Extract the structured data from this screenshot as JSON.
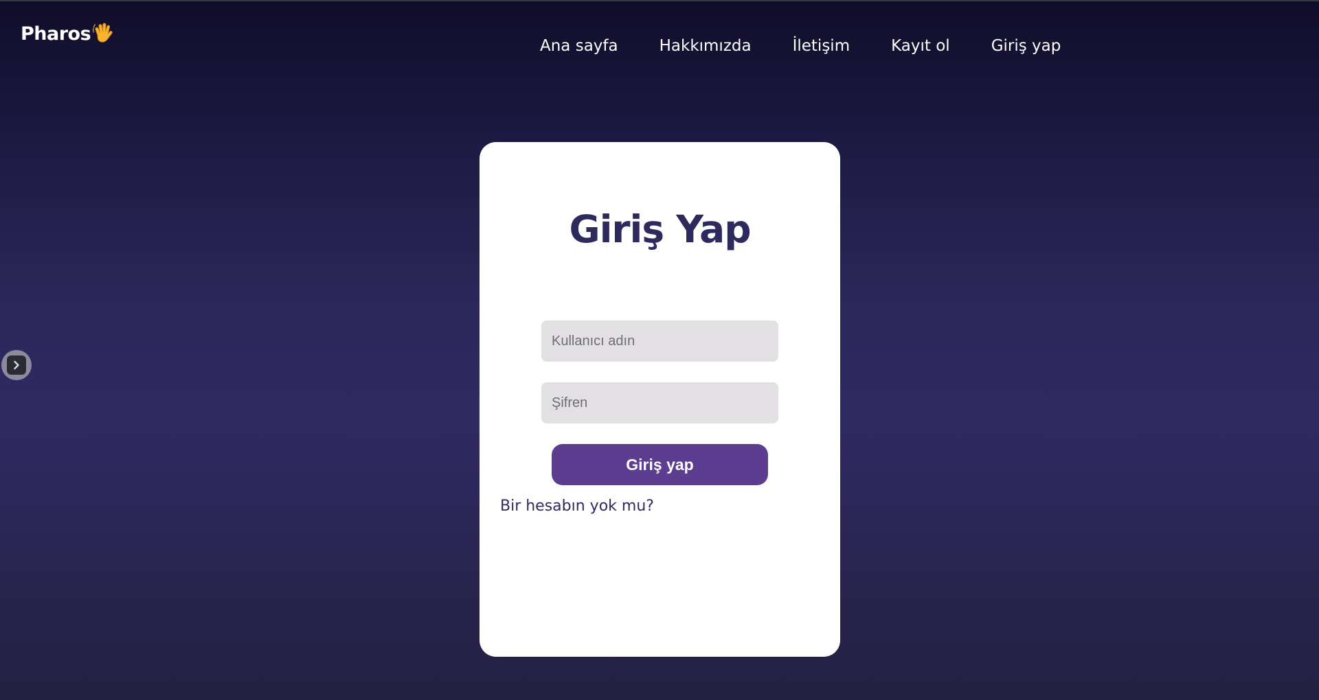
{
  "brand": {
    "name": "Pharos",
    "icon": "waving-hand-icon"
  },
  "nav": {
    "items": [
      {
        "label": "Ana sayfa"
      },
      {
        "label": "Hakkımızda"
      },
      {
        "label": "İletişim"
      },
      {
        "label": "Kayıt ol"
      },
      {
        "label": "Giriş yap"
      }
    ]
  },
  "sidebar_toggle": {
    "icon": "chevron-right-icon"
  },
  "login": {
    "title": "Giriş Yap",
    "username": {
      "placeholder": "Kullanıcı adın",
      "value": ""
    },
    "password": {
      "placeholder": "Şifren",
      "value": ""
    },
    "submit_label": "Giriş yap",
    "signup_prompt": "Bir hesabın yok mu?"
  },
  "colors": {
    "accent": "#5c3d8f",
    "title": "#2e2a5e",
    "background_top": "#100d29",
    "background_mid": "#302a63",
    "card": "#ffffff",
    "input_bg": "#e2e0e2"
  }
}
